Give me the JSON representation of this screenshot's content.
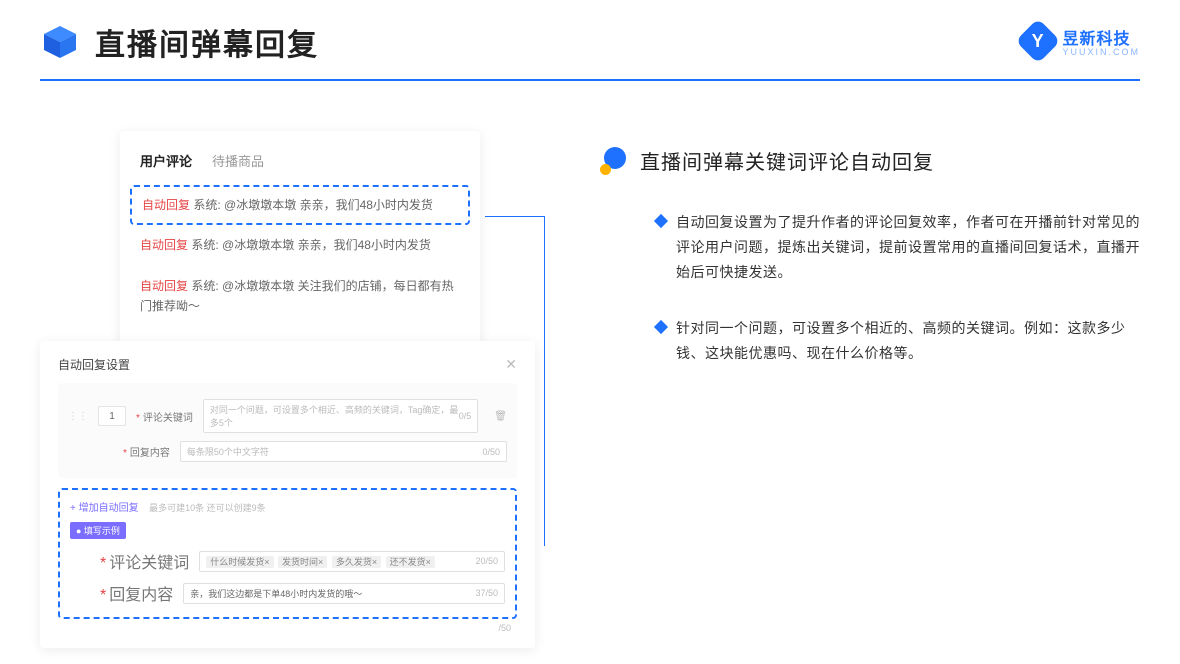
{
  "header": {
    "title": "直播间弹幕回复",
    "brand_name": "昱新科技",
    "brand_url": "YUUXIN.COM"
  },
  "card1": {
    "tab_active": "用户评论",
    "tab_inactive": "待播商品",
    "badge": "自动回复",
    "sys_prefix": "系统:",
    "comment1_user": "@冰墩墩本墩",
    "comment1_text": "亲亲，我们48小时内发货",
    "comment2_user": "@冰墩墩本墩",
    "comment2_text": "亲亲，我们48小时内发货",
    "comment3_user": "@冰墩墩本墩",
    "comment3_text": "关注我们的店铺，每日都有热门推荐呦～"
  },
  "card2": {
    "title": "自动回复设置",
    "index": "1",
    "keyword_label": "评论关键词",
    "keyword_placeholder": "对同一个问题，可设置多个相近、高频的关键词，Tag确定，最多5个",
    "keyword_count": "0/5",
    "content_label": "回复内容",
    "content_placeholder": "每条限50个中文字符",
    "content_count": "0/50",
    "add_text": "+ 增加自动回复",
    "add_hint": "最多可建10条 还可以创建9条",
    "proto_label": "● 填写示例",
    "ex_keyword_label": "评论关键词",
    "ex_kw1": "什么时候发货×",
    "ex_kw2": "发货时间×",
    "ex_kw3": "多久发货×",
    "ex_kw4": "还不发货×",
    "ex_kw_count": "20/50",
    "ex_content_label": "回复内容",
    "ex_content_text": "亲，我们这边都是下单48小时内发货的哦～",
    "ex_content_count": "37/50",
    "trailing_count": "/50"
  },
  "right": {
    "section_title": "直播间弹幕关键词评论自动回复",
    "bullet1": "自动回复设置为了提升作者的评论回复效率，作者可在开播前针对常见的评论用户问题，提炼出关键词，提前设置常用的直播间回复话术，直播开始后可快捷发送。",
    "bullet2": "针对同一个问题，可设置多个相近的、高频的关键词。例如：这款多少钱、这块能优惠吗、现在什么价格等。"
  }
}
